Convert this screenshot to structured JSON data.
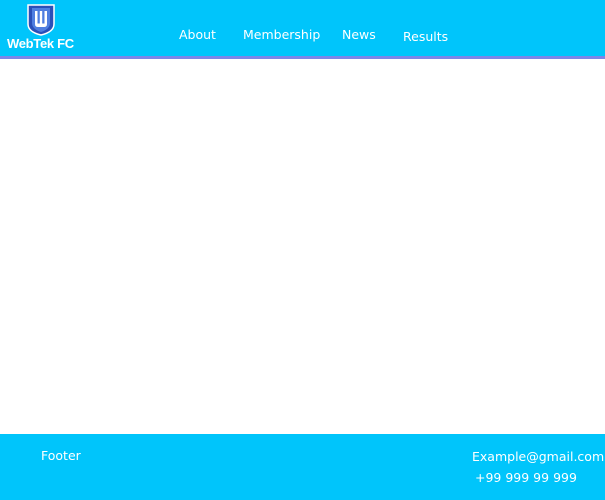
{
  "brand": {
    "name": "WebTek FC",
    "logo_icon": "shield-logo-icon",
    "logo_letter": "W"
  },
  "nav": {
    "items": [
      {
        "label": "About"
      },
      {
        "label": "Membership"
      },
      {
        "label": "News"
      },
      {
        "label": "Results"
      }
    ]
  },
  "footer": {
    "label": "Footer",
    "email": "Example@gmail.com",
    "phone": "+99 999 99 999"
  },
  "colors": {
    "header_bg": "#00c5fb",
    "header_border": "#7d86e8",
    "footer_bg": "#00c5fb",
    "shield_blue": "#2a4fb8",
    "text": "#ffffff"
  }
}
